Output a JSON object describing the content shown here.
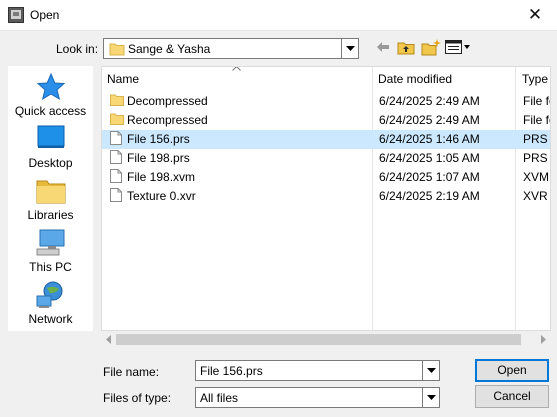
{
  "window": {
    "title": "Open",
    "close_glyph": "✕"
  },
  "look_in": {
    "label": "Look in:",
    "value": "Sange & Yasha"
  },
  "toolbar": {
    "back": "back-arrow-icon",
    "up": "up-folder-icon",
    "new_folder": "new-folder-icon",
    "view": "view-menu-icon"
  },
  "places": [
    {
      "label": "Quick access",
      "icon": "star-icon"
    },
    {
      "label": "Desktop",
      "icon": "desktop-icon"
    },
    {
      "label": "Libraries",
      "icon": "libraries-icon"
    },
    {
      "label": "This PC",
      "icon": "computer-icon"
    },
    {
      "label": "Network",
      "icon": "network-icon"
    }
  ],
  "columns": {
    "name": "Name",
    "date": "Date modified",
    "type": "Type"
  },
  "files": [
    {
      "name": "Decompressed",
      "date": "6/24/2025 2:49 AM",
      "type": "File fo",
      "kind": "folder",
      "selected": false
    },
    {
      "name": "Recompressed",
      "date": "6/24/2025 2:49 AM",
      "type": "File fo",
      "kind": "folder",
      "selected": false
    },
    {
      "name": "File 156.prs",
      "date": "6/24/2025 1:46 AM",
      "type": "PRS F",
      "kind": "file",
      "selected": true
    },
    {
      "name": "File 198.prs",
      "date": "6/24/2025 1:05 AM",
      "type": "PRS F",
      "kind": "file",
      "selected": false
    },
    {
      "name": "File 198.xvm",
      "date": "6/24/2025 1:07 AM",
      "type": "XVM",
      "kind": "file",
      "selected": false
    },
    {
      "name": "Texture 0.xvr",
      "date": "6/24/2025 2:19 AM",
      "type": "XVR F",
      "kind": "file",
      "selected": false
    }
  ],
  "file_name": {
    "label": "File name:",
    "value": "File 156.prs"
  },
  "file_type": {
    "label": "Files of type:",
    "value": "All files"
  },
  "buttons": {
    "open": "Open",
    "cancel": "Cancel"
  },
  "colors": {
    "selection": "#cce8ff",
    "accent": "#0078d7",
    "folder": "#f8d775"
  }
}
